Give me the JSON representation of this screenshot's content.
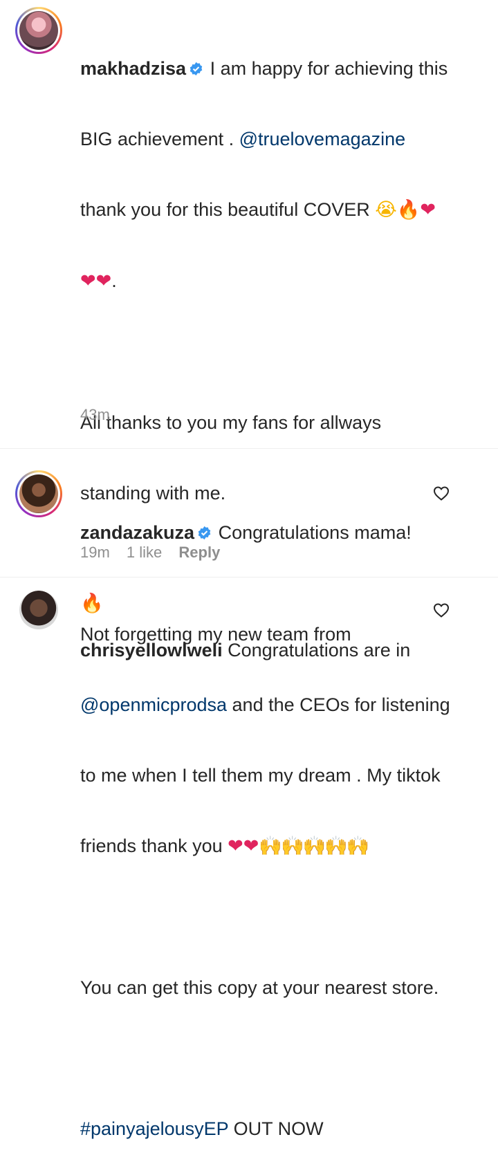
{
  "post": {
    "username": "makhadzisa",
    "verified": true,
    "text_lines": [
      {
        "parts": [
          {
            "t": "I am happy for achieving this",
            "k": "plain"
          }
        ]
      },
      {
        "parts": [
          {
            "t": "BIG achievement . ",
            "k": "plain"
          },
          {
            "t": "@truelovemagazine",
            "k": "mention"
          }
        ]
      },
      {
        "parts": [
          {
            "t": "thank you for this beautiful COVER ",
            "k": "plain"
          }
        ]
      },
      {
        "parts": []
      },
      {
        "parts": []
      },
      {
        "parts": [
          {
            "t": "All thanks to you my fans for allways",
            "k": "plain"
          }
        ]
      },
      {
        "parts": [
          {
            "t": "standing with me.",
            "k": "plain"
          }
        ]
      },
      {
        "parts": []
      },
      {
        "parts": [
          {
            "t": "Not forgetting my new team from",
            "k": "plain"
          }
        ]
      },
      {
        "parts": [
          {
            "t": "@openmicprodsa",
            "k": "mention"
          },
          {
            "t": " and the CEOs for listening",
            "k": "plain"
          }
        ]
      },
      {
        "parts": [
          {
            "t": "to me when I tell them my dream . My tiktok",
            "k": "plain"
          }
        ]
      },
      {
        "parts": [
          {
            "t": "friends thank you ",
            "k": "plain"
          }
        ]
      },
      {
        "parts": []
      },
      {
        "parts": [
          {
            "t": "You can get this copy at your nearest store.",
            "k": "plain"
          }
        ]
      },
      {
        "parts": []
      },
      {
        "parts": [
          {
            "t": "#painyajelousyEP",
            "k": "hashtag"
          },
          {
            "t": " OUT NOW",
            "k": "plain"
          }
        ]
      }
    ],
    "time": "43m"
  },
  "comments": [
    {
      "username": "zandazakuza",
      "verified": true,
      "text": "Congratulations mama!",
      "time": "19m",
      "likes": "1 like",
      "reply_label": "Reply"
    },
    {
      "username": "chrisyellowlweli",
      "verified": false,
      "text": "Congratulations are in",
      "time": "",
      "likes": "",
      "reply_label": ""
    }
  ],
  "colors": {
    "mention": "#00376b",
    "verified": "#3897f0",
    "meta": "#8e8e8e"
  },
  "icons": [
    "verified-badge-icon",
    "heart-outline-icon",
    "heart-emoji",
    "fire-emoji",
    "crying-emoji",
    "raised-hands-emoji"
  ]
}
